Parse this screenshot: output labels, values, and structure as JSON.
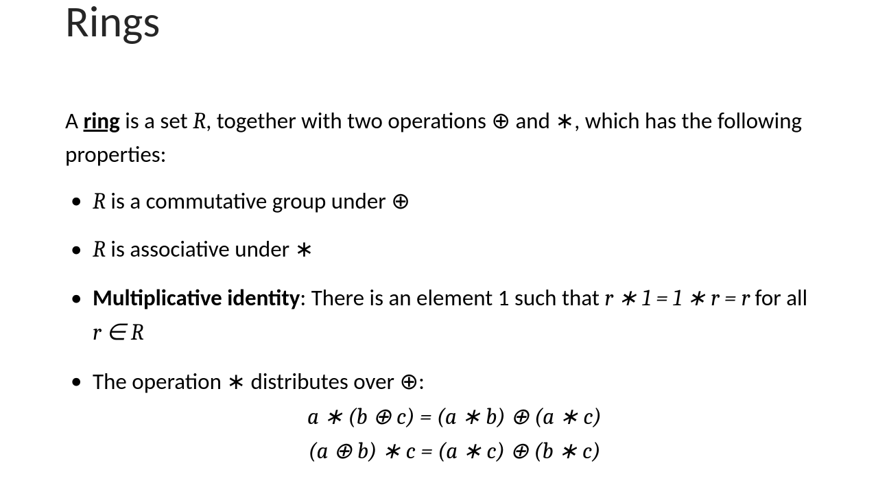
{
  "title": "Rings",
  "def": {
    "pre": "A ",
    "term": "ring",
    "mid1": " is a set ",
    "R": "R",
    "mid2": ", together with two operations ",
    "oplus": "⊕",
    "mid3": " and ",
    "ast": "∗",
    "tail": ", which has the following properties:"
  },
  "b1": {
    "R": "R",
    "text": " is a commutative group under ",
    "oplus": "⊕"
  },
  "b2": {
    "R": "R",
    "text": " is associative under ",
    "ast": "∗"
  },
  "b3": {
    "head": "Multiplicative identity",
    "colon": ": There is an element 1 such that ",
    "eq": "r ∗ 1 = 1 ∗ r = r",
    "forall": " for all ",
    "rinR": "r ∈ R"
  },
  "b4": {
    "pre": "The operation ",
    "ast": "∗",
    "mid": " distributes over ",
    "oplus": "⊕",
    "colon": ":"
  },
  "eqs": {
    "line1": "a ∗ (b ⊕ c) = (a ∗ b) ⊕ (a ∗ c)",
    "line2": "(a ⊕ b) ∗ c = (a ∗ c) ⊕ (b ∗ c)"
  }
}
